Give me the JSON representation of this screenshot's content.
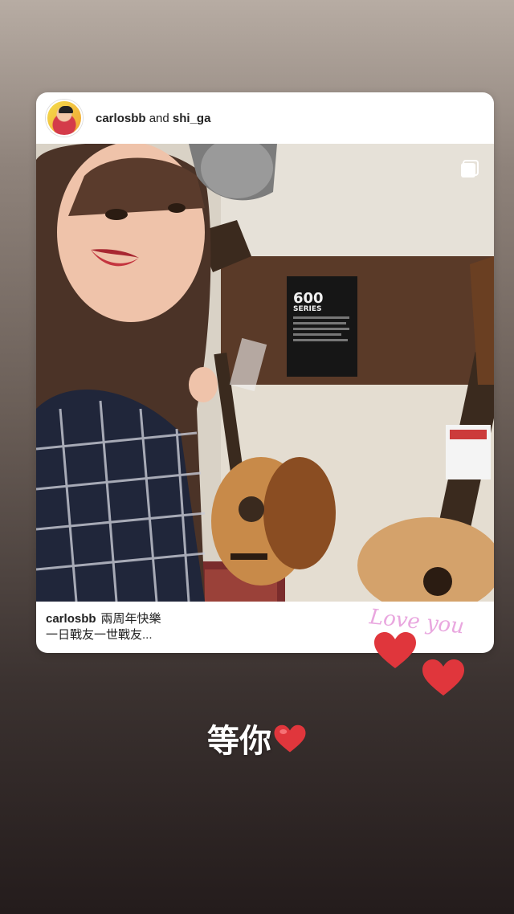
{
  "shared_post": {
    "header": {
      "user1": "carlosbb",
      "connector": " and ",
      "user2": "shi_ga"
    },
    "photo_sign": {
      "title": "600",
      "subtitle": "SERIES"
    },
    "caption": {
      "username": "carlosbb",
      "line1": "兩周年快樂",
      "line2": "一日戰友一世戰友..."
    }
  },
  "sticker": {
    "text": "Love you",
    "icon": "heart-icon"
  },
  "story_text": {
    "text": "等你",
    "emoji": "heart-emoji"
  },
  "colors": {
    "sticker_text": "#e9a7df",
    "heart": "#e0363c",
    "text": "#ffffff"
  }
}
